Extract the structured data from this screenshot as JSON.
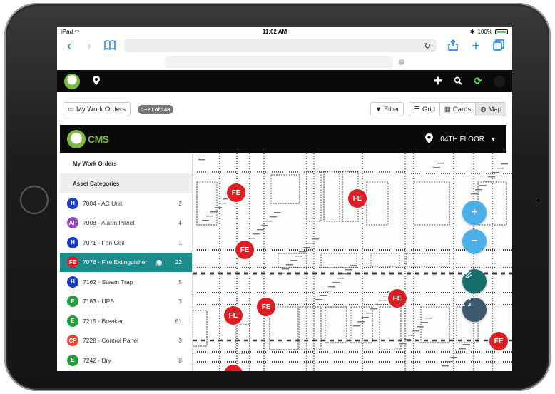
{
  "status": {
    "device": "iPad",
    "time": "11:02 AM",
    "battery": "100%"
  },
  "browser": {
    "reload_icon": "reload-icon"
  },
  "toolbar": {
    "my_work_orders": "My Work Orders",
    "count": "1–20 of 148",
    "filter": "Filter",
    "grid": "Grid",
    "cards": "Cards",
    "map": "Map"
  },
  "cms": {
    "logo_text": "CMS",
    "floor": "04TH FLOOR"
  },
  "sidebar": {
    "my_work_orders": "My Work Orders",
    "asset_categories": "Asset Categories",
    "items": [
      {
        "badge": "H",
        "color": "#1a3fc4",
        "label": "7004 - AC Unit",
        "count": "2"
      },
      {
        "badge": "AP",
        "color": "#9b3fc4",
        "label": "7008 - Alarm Panel",
        "count": "4"
      },
      {
        "badge": "H",
        "color": "#1a3fc4",
        "label": "7071 - Fan Coil",
        "count": "1"
      },
      {
        "badge": "FE",
        "color": "#e11b22",
        "label": "7076 - Fire Extinguisher",
        "count": "22"
      },
      {
        "badge": "H",
        "color": "#1a3fc4",
        "label": "7162 - Steam Trap",
        "count": "5"
      },
      {
        "badge": "E",
        "color": "#1f9e3a",
        "label": "7183 - UPS",
        "count": "3"
      },
      {
        "badge": "E",
        "color": "#1f9e3a",
        "label": "7215 - Breaker",
        "count": "61"
      },
      {
        "badge": "CP",
        "color": "#e8442a",
        "label": "7228 - Control Panel",
        "count": "3"
      },
      {
        "badge": "E",
        "color": "#1f9e3a",
        "label": "7242 - Dry",
        "count": "8"
      }
    ]
  },
  "map": {
    "marker_label": "FE",
    "zoom_in": "+",
    "zoom_out": "−",
    "layers_icon": "layers-icon",
    "fullscreen_icon": "fullscreen-icon"
  }
}
